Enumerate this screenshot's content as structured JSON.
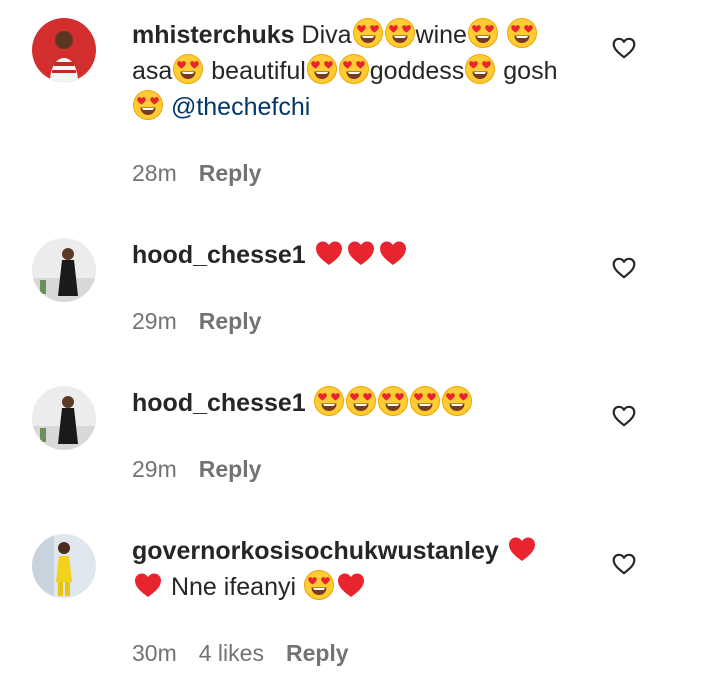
{
  "comments": [
    {
      "username": "mhisterchuks",
      "segments": [
        "Diva",
        "wine",
        "asa",
        " beautiful",
        "goddess",
        "gosh"
      ],
      "mention": "@thechefchi",
      "time": "28m",
      "likes": "",
      "reply_label": "Reply",
      "avatar_bg": "#d32f2f"
    },
    {
      "username": "hood_chesse1",
      "time": "29m",
      "likes": "",
      "reply_label": "Reply",
      "avatar_bg": "#e8e8e8"
    },
    {
      "username": "hood_chesse1",
      "time": "29m",
      "likes": "",
      "reply_label": "Reply",
      "avatar_bg": "#e8e8e8"
    },
    {
      "username": "governorkosisochukwustanley",
      "segments": [
        "Nne ifeanyi"
      ],
      "time": "30m",
      "likes": "4 likes",
      "reply_label": "Reply",
      "avatar_bg": "#dfe6ee"
    }
  ],
  "icons": {
    "like": "heart-outline-icon",
    "heart_eyes": "smiling-face-with-heart-eyes-icon",
    "red_heart": "red-heart-icon"
  },
  "colors": {
    "text": "#262626",
    "meta": "#737373",
    "mention": "#00376b",
    "red_heart": "#e8252f",
    "emoji_face": "#ffcc33"
  }
}
